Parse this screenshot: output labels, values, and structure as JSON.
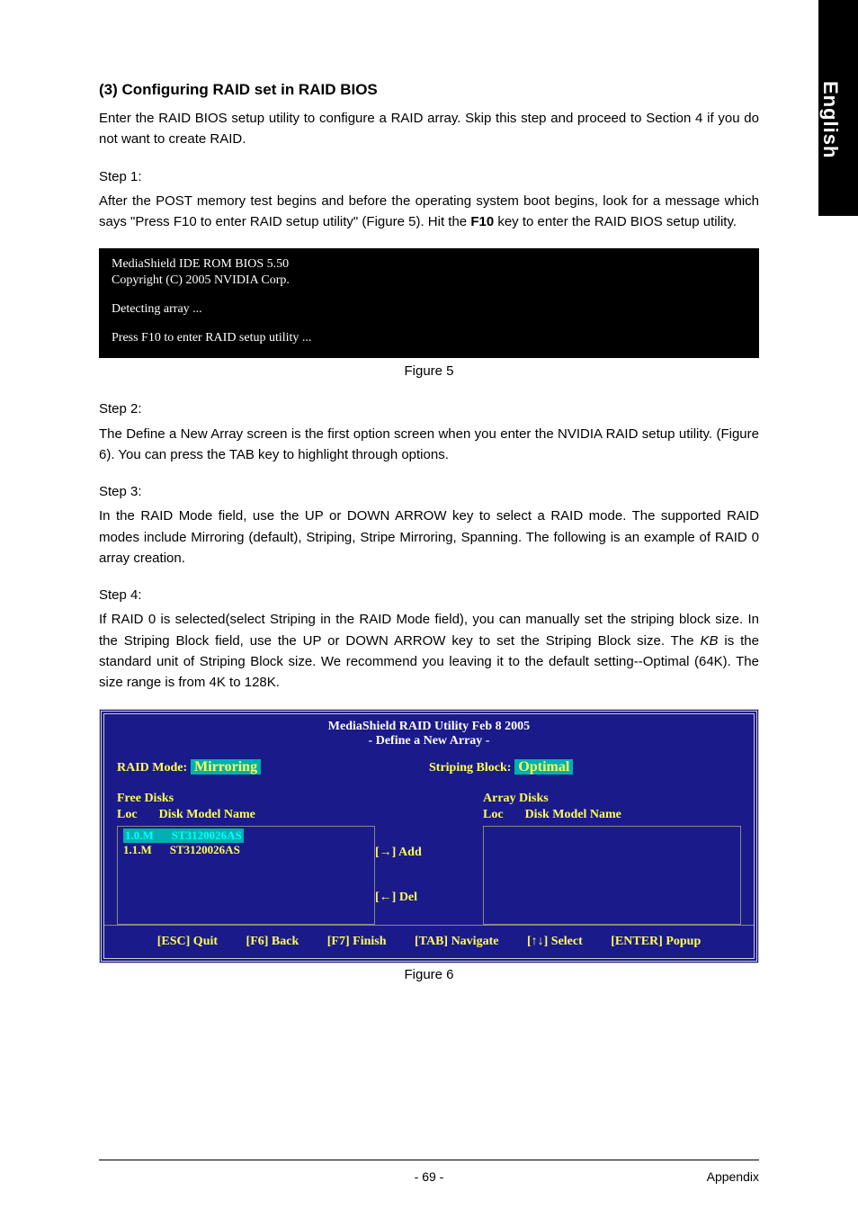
{
  "side_tab": "English",
  "heading": "(3)  Configuring RAID set in RAID BIOS",
  "intro": "Enter the RAID BIOS setup utility to configure a RAID array. Skip this step and proceed to Section 4 if you do not want to create RAID.",
  "step1": {
    "label": "Step 1:",
    "body_before": "After the POST memory test begins and before the operating system boot begins, look for a message which says \"Press F10 to enter RAID setup utility\" (Figure 5). Hit the ",
    "key": "F10",
    "body_after": " key to enter the RAID BIOS setup utility."
  },
  "blackbox": {
    "l1": "MediaShield IDE ROM BIOS 5.50",
    "l2": "Copyright (C) 2005 NVIDIA Corp.",
    "l3": "Detecting array ...",
    "l4": "Press F10 to enter RAID setup utility ..."
  },
  "fig5": "Figure 5",
  "step2": {
    "label": "Step 2:",
    "body": "The Define a New Array screen is the first option screen when you enter the NVIDIA RAID setup utility. (Figure 6). You can press the TAB key to highlight through options."
  },
  "step3": {
    "label": "Step 3:",
    "body": "In the RAID Mode field, use the UP or DOWN ARROW key to select a RAID mode. The supported RAID modes include Mirroring (default), Striping, Stripe Mirroring, Spanning. The following is an example of RAID 0 array creation."
  },
  "step4": {
    "label": "Step 4:",
    "body_before": "If RAID 0 is selected(select Striping in the RAID Mode field), you can manually set the striping block size. In the Striping Block field, use the UP or DOWN ARROW key to set the Striping Block size. The ",
    "kb": "KB",
    "body_after": " is the standard unit of Striping Block size. We recommend you leaving it to the default setting--Optimal (64K). The size range is from 4K to 128K."
  },
  "bios": {
    "title1": "MediaShield RAID Utility  Feb 8 2005",
    "title2": "- Define a New Array -",
    "raid_mode_label": "RAID Mode:",
    "raid_mode_value": "Mirroring",
    "striping_label": "Striping Block:",
    "striping_value": "Optimal",
    "free_disks": "Free Disks",
    "array_disks": "Array Disks",
    "loc": "Loc",
    "model": "Disk Model Name",
    "rows": [
      {
        "loc": "1.0.M",
        "model": "ST3120026AS",
        "selected": true
      },
      {
        "loc": "1.1.M",
        "model": "ST3120026AS",
        "selected": false
      }
    ],
    "add": "[→]  Add",
    "del": "[←]  Del",
    "foot": {
      "esc": "[ESC] Quit",
      "f6": "[F6] Back",
      "f7": "[F7] Finish",
      "tab": "[TAB] Navigate",
      "sel": "[↑↓] Select",
      "enter": "[ENTER] Popup"
    }
  },
  "fig6": "Figure 6",
  "footer": {
    "page": "- 69 -",
    "right": "Appendix"
  }
}
